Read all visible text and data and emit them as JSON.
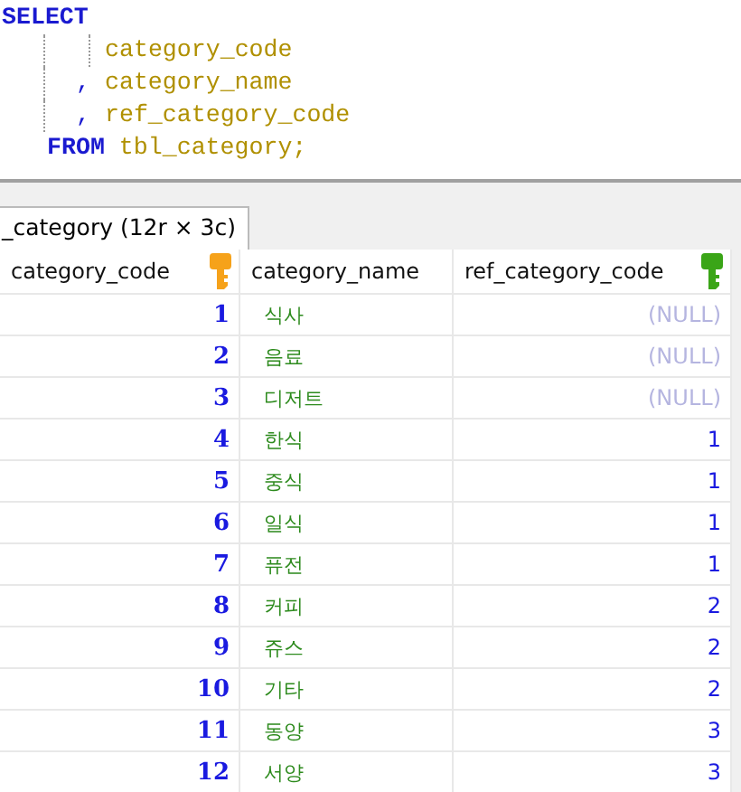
{
  "editor": {
    "lines": [
      [
        {
          "kind": "keyword",
          "text": "SELECT"
        }
      ],
      [
        {
          "kind": "column",
          "text": "category_code"
        }
      ],
      [
        {
          "kind": "punct",
          "text": ","
        },
        {
          "kind": "column",
          "text": "category_name"
        }
      ],
      [
        {
          "kind": "punct",
          "text": ","
        },
        {
          "kind": "column",
          "text": "ref_category_code"
        }
      ],
      [
        {
          "kind": "keyword",
          "text": "FROM"
        },
        {
          "kind": "column",
          "text": "tbl_category;"
        }
      ]
    ]
  },
  "result_tab": {
    "label": "_category (12r × 3c)",
    "selected": true
  },
  "table": {
    "columns": [
      {
        "label": "category_code",
        "kind": "primary"
      },
      {
        "label": "category_name",
        "kind": "plain"
      },
      {
        "label": "ref_category_code",
        "kind": "foreign"
      }
    ],
    "rows": [
      {
        "category_code": "1",
        "category_name": "식사",
        "ref_category_code": "(NULL)",
        "is_null": true
      },
      {
        "category_code": "2",
        "category_name": "음료",
        "ref_category_code": "(NULL)",
        "is_null": true
      },
      {
        "category_code": "3",
        "category_name": "디저트",
        "ref_category_code": "(NULL)",
        "is_null": true
      },
      {
        "category_code": "4",
        "category_name": "한식",
        "ref_category_code": "1",
        "is_null": false
      },
      {
        "category_code": "5",
        "category_name": "중식",
        "ref_category_code": "1",
        "is_null": false
      },
      {
        "category_code": "6",
        "category_name": "일식",
        "ref_category_code": "1",
        "is_null": false
      },
      {
        "category_code": "7",
        "category_name": "퓨전",
        "ref_category_code": "1",
        "is_null": false
      },
      {
        "category_code": "8",
        "category_name": "커피",
        "ref_category_code": "2",
        "is_null": false
      },
      {
        "category_code": "9",
        "category_name": "쥬스",
        "ref_category_code": "2",
        "is_null": false
      },
      {
        "category_code": "10",
        "category_name": "기타",
        "ref_category_code": "2",
        "is_null": false
      },
      {
        "category_code": "11",
        "category_name": "동양",
        "ref_category_code": "3",
        "is_null": false
      },
      {
        "category_code": "12",
        "category_name": "서양",
        "ref_category_code": "3",
        "is_null": false
      }
    ]
  }
}
